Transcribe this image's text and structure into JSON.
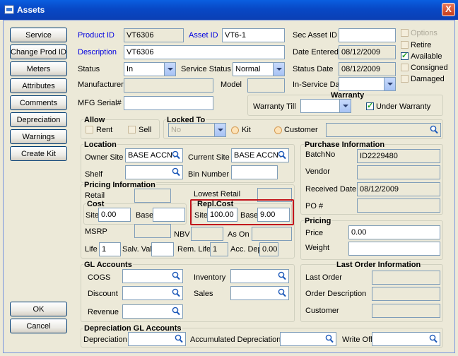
{
  "window": {
    "title": "Assets",
    "close": "X"
  },
  "left_buttons": [
    "Service",
    "Change Prod ID",
    "Meters",
    "Attributes",
    "Comments",
    "Depreciation",
    "Warnings",
    "Create Kit"
  ],
  "bottom_buttons": {
    "ok": "OK",
    "cancel": "Cancel"
  },
  "header": {
    "product_id_label": "Product ID",
    "product_id": "VT6306",
    "asset_id_label": "Asset ID",
    "asset_id": "VT6-1",
    "sec_asset_id_label": "Sec Asset ID",
    "sec_asset_id": "",
    "description_label": "Description",
    "description": "VT6306",
    "date_entered_label": "Date Entered",
    "date_entered": "08/12/2009",
    "status_label": "Status",
    "status": "In",
    "service_status_label": "Service Status",
    "service_status": "Normal",
    "status_date_label": "Status Date",
    "status_date": "08/12/2009",
    "manufacturer_label": "Manufacturer",
    "model_label": "Model",
    "in_service_date_label": "In-Service Date",
    "mfg_serial_label": "MFG Serial#"
  },
  "flags": {
    "options": "Options",
    "retire": "Retire",
    "available": "Available",
    "consigned": "Consigned",
    "damaged": "Damaged"
  },
  "warranty": {
    "title": "Warranty",
    "till_label": "Warranty Till",
    "under_warranty": "Under Warranty"
  },
  "allow": {
    "title": "Allow",
    "rent": "Rent",
    "sell": "Sell"
  },
  "locked_to": {
    "title": "Locked To",
    "value": "No",
    "kit": "Kit",
    "customer": "Customer"
  },
  "location": {
    "title": "Location",
    "owner_site_label": "Owner Site",
    "owner_site": "BASE ACCNT",
    "current_site_label": "Current Site",
    "current_site": "BASE ACCNT",
    "shelf_label": "Shelf",
    "bin_label": "Bin Number"
  },
  "purchase": {
    "title": "Purchase Information",
    "batch_label": "BatchNo",
    "batch": "ID2229480",
    "vendor_label": "Vendor",
    "received_label": "Received Date",
    "received": "08/12/2009",
    "po_label": "PO #"
  },
  "pricing_info": {
    "title": "Pricing Information",
    "retail_label": "Retail",
    "lowest_retail_label": "Lowest Retail",
    "cost_title": "Cost",
    "site_label": "Site",
    "cost_site": "0.00",
    "base_label": "Base",
    "cost_base": "",
    "repl_title": "Repl.Cost",
    "repl_site": "100.00",
    "repl_base": "9.00",
    "msrp_label": "MSRP",
    "nbv_label": "NBV",
    "as_on_label": "As On",
    "life_label": "Life",
    "life": "1",
    "salv_label": "Salv. Val",
    "rem_life_label": "Rem. Life",
    "rem_life": "1",
    "acc_dep_label": "Acc. Dep",
    "acc_dep": "0.00"
  },
  "pricing": {
    "title": "Pricing",
    "price_label": "Price",
    "price": "0.00",
    "weight_label": "Weight"
  },
  "gl": {
    "title": "GL Accounts",
    "cogs": "COGS",
    "inventory": "Inventory",
    "discount": "Discount",
    "sales": "Sales",
    "revenue": "Revenue"
  },
  "last_order": {
    "title": "Last Order Information",
    "last_order": "Last Order",
    "order_desc": "Order Description",
    "customer": "Customer"
  },
  "dep_gl": {
    "title": "Depreciation GL Accounts",
    "depreciation": "Depreciation",
    "accumulated": "Accumulated Depreciation",
    "write_off": "Write Off"
  }
}
